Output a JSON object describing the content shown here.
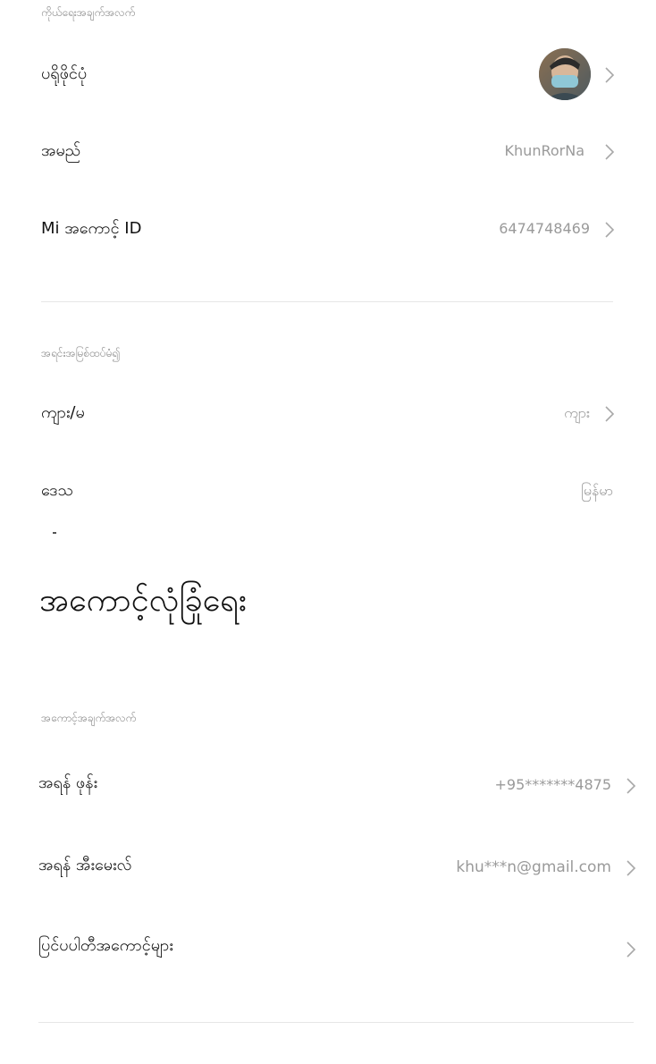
{
  "personal_info": {
    "section_label": "ကိုယ်ရေးအချက်အလက်",
    "profile_photo_label": "ပရိုဖိုင်ပုံ",
    "name_label": "အမည်",
    "name_value": "KhunRorNa",
    "mi_account_label": "Mi အကောင့် ID",
    "mi_account_value": "6474748469"
  },
  "basic_settings": {
    "section_label": "အရင်းအမြစ်ထပ်မံ၍",
    "gender_label": "ကျား/မ",
    "gender_value": "ကျား",
    "region_label": "ဒေသ",
    "region_value": "မြန်မာ"
  },
  "account_security": {
    "title": "အကောင့်လုံခြုံရေး",
    "section_label": "အကောင့်အချက်အလက်",
    "phone_label": "အရန် ဖုန်း",
    "phone_value": "+95*******4875",
    "email_label": "အရန် အီးမေးလ်",
    "email_value": "khu***n@gmail.com",
    "linked_accounts_label": "ပြင်ပပါတီအကောင့်များ"
  },
  "icons": {
    "chevron": "chevron-right-icon",
    "avatar": "user-avatar"
  },
  "colors": {
    "primary_text": "#111111",
    "secondary_text": "#9a9a9a",
    "divider": "#e6e6e6"
  }
}
